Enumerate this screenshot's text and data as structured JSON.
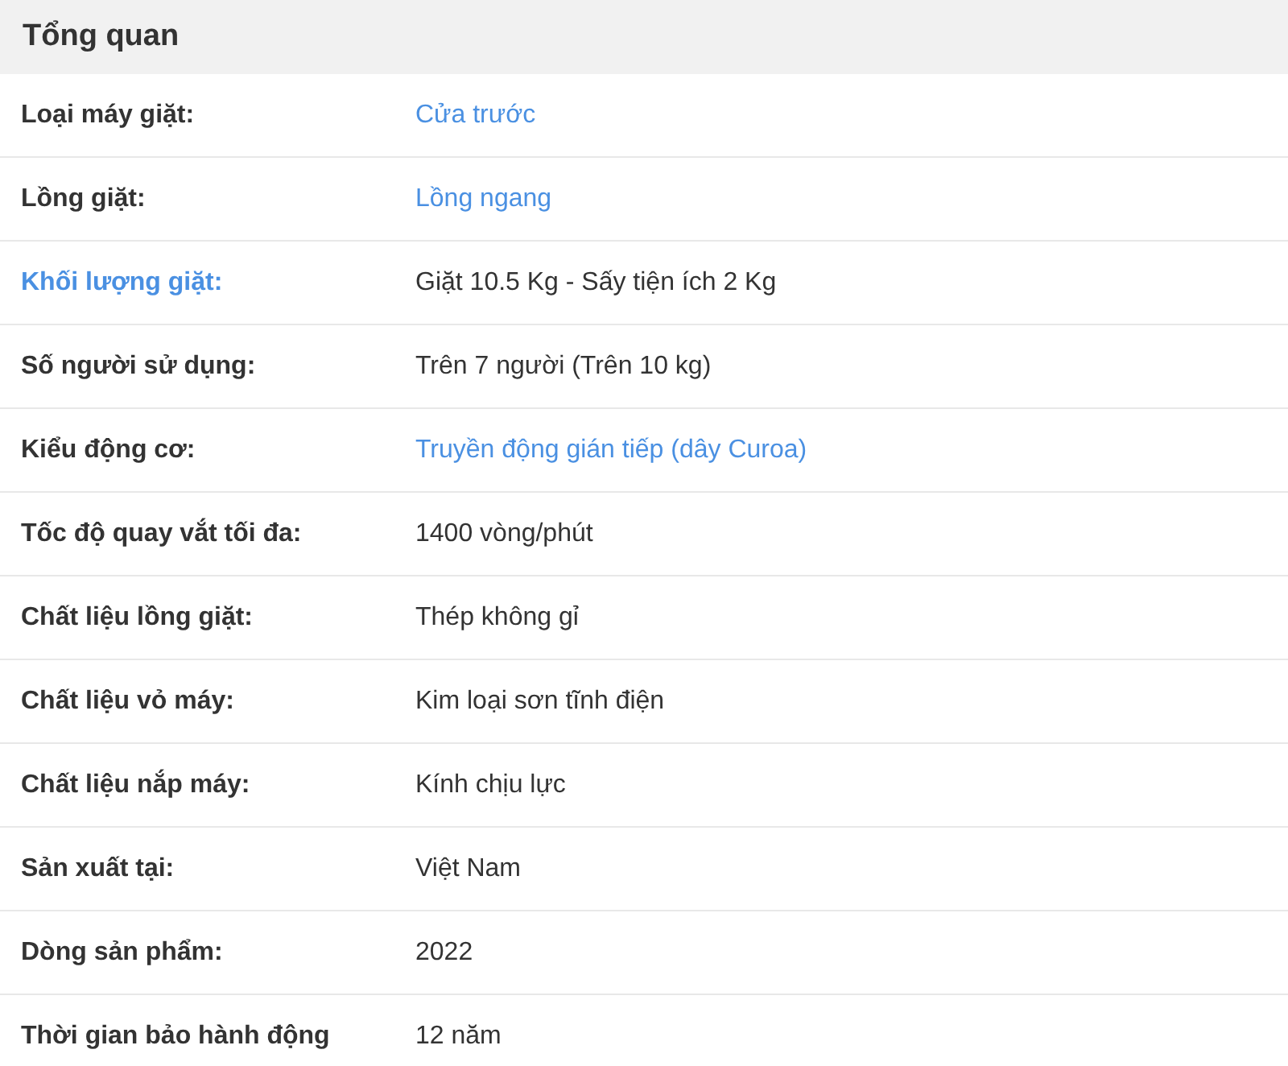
{
  "section": {
    "title": "Tổng quan"
  },
  "rows": [
    {
      "label": "Loại máy giặt:",
      "value": "Cửa trước",
      "label_link": false,
      "value_link": true
    },
    {
      "label": "Lồng giặt:",
      "value": "Lồng ngang",
      "label_link": false,
      "value_link": true
    },
    {
      "label": "Khối lượng giặt:",
      "value": "Giặt 10.5 Kg - Sấy tiện ích 2 Kg",
      "label_link": true,
      "value_link": false
    },
    {
      "label": "Số người sử dụng:",
      "value": "Trên 7 người (Trên 10 kg)",
      "label_link": false,
      "value_link": false
    },
    {
      "label": "Kiểu động cơ:",
      "value": "Truyền động gián tiếp (dây Curoa)",
      "label_link": false,
      "value_link": true
    },
    {
      "label": "Tốc độ quay vắt tối đa:",
      "value": "1400 vòng/phút",
      "label_link": false,
      "value_link": false
    },
    {
      "label": "Chất liệu lồng giặt:",
      "value": "Thép không gỉ",
      "label_link": false,
      "value_link": false
    },
    {
      "label": "Chất liệu vỏ máy:",
      "value": "Kim loại sơn tĩnh điện",
      "label_link": false,
      "value_link": false
    },
    {
      "label": "Chất liệu nắp máy:",
      "value": "Kính chịu lực",
      "label_link": false,
      "value_link": false
    },
    {
      "label": "Sản xuất tại:",
      "value": "Việt Nam",
      "label_link": false,
      "value_link": false
    },
    {
      "label": "Dòng sản phẩm:",
      "value": "2022",
      "label_link": false,
      "value_link": false
    },
    {
      "label": "Thời gian bảo hành động",
      "value": "12 năm",
      "label_link": false,
      "value_link": false
    }
  ]
}
